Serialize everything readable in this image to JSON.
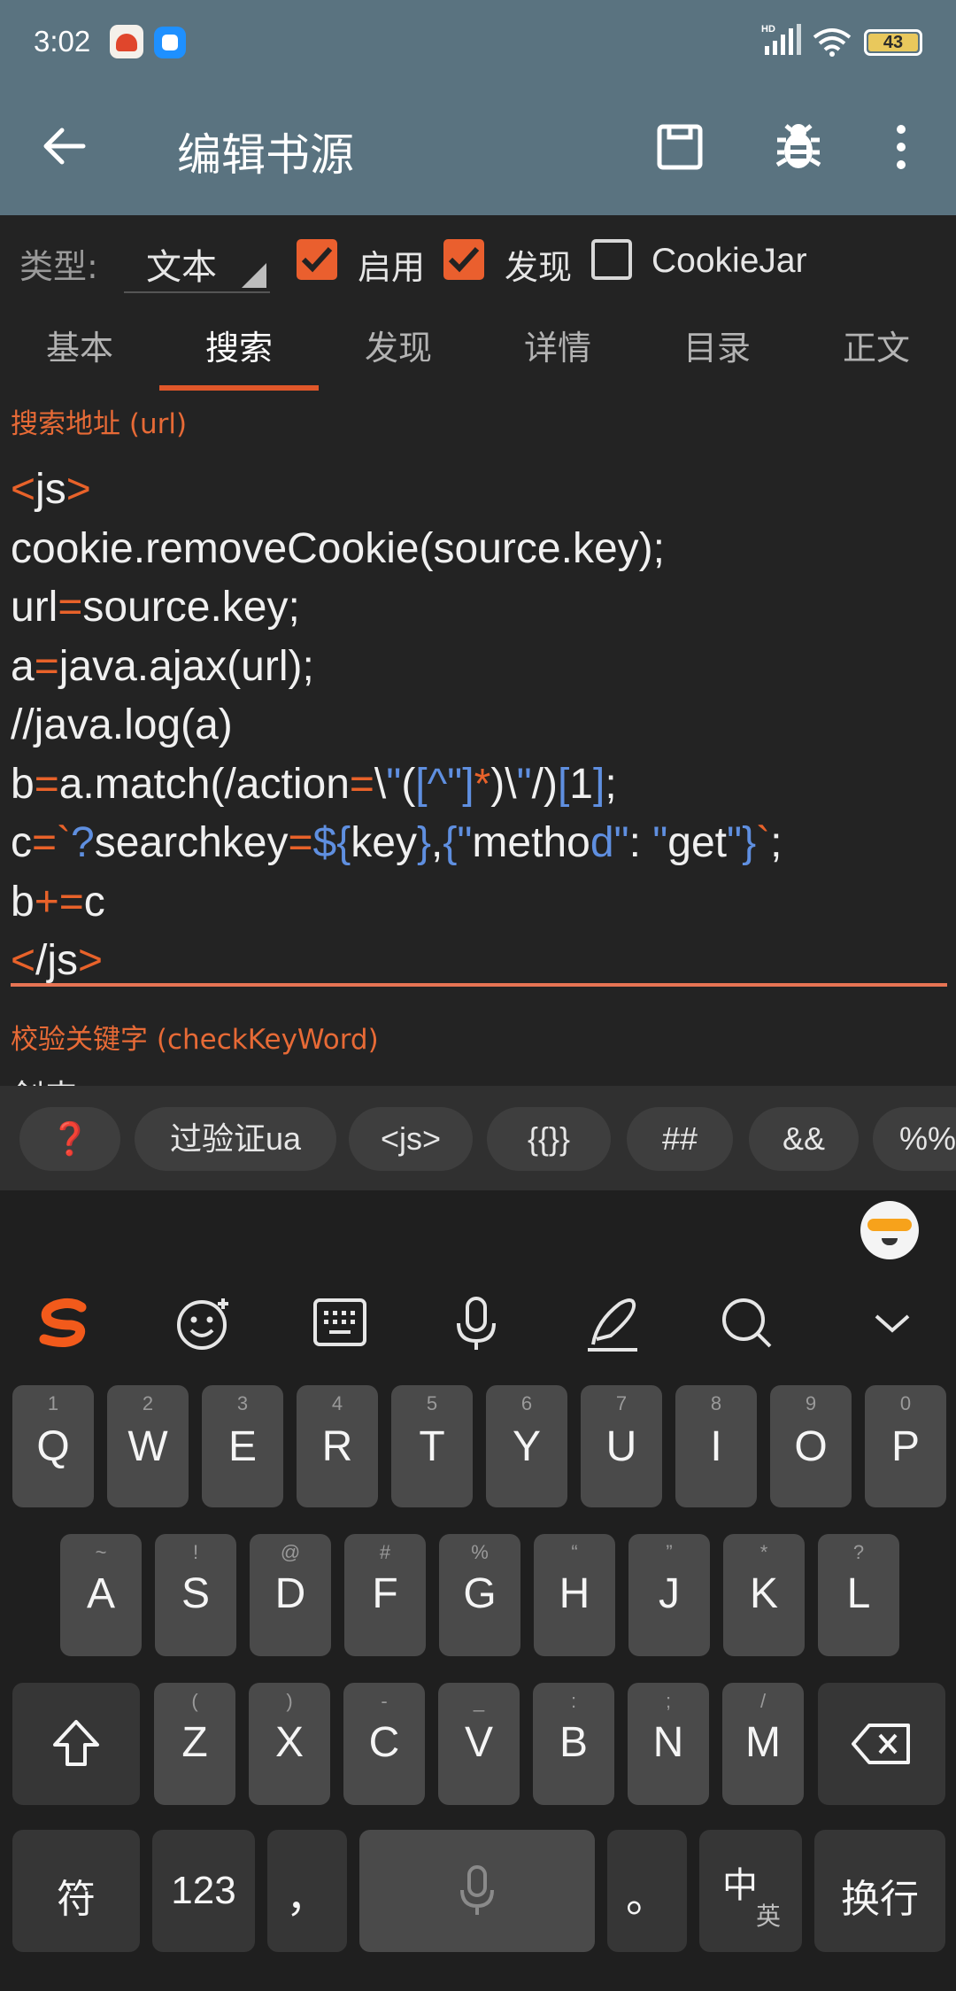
{
  "status": {
    "time": "3:02",
    "battery": "43",
    "battery_level": 0.43
  },
  "appbar": {
    "title": "编辑书源"
  },
  "options": {
    "type_label": "类型:",
    "type_value": "文本",
    "enable_label": "启用",
    "enable_checked": true,
    "discover_label": "发现",
    "discover_checked": true,
    "cookiejar_label": "CookieJar",
    "cookiejar_checked": false
  },
  "tabs": [
    {
      "label": "基本",
      "active": false
    },
    {
      "label": "搜索",
      "active": true
    },
    {
      "label": "发现",
      "active": false
    },
    {
      "label": "详情",
      "active": false
    },
    {
      "label": "目录",
      "active": false
    },
    {
      "label": "正文",
      "active": false
    }
  ],
  "editor": {
    "search_url_label": "搜索地址 (url)",
    "code_lines": [
      "<js>",
      "cookie.removeCookie(source.key);",
      "url=source.key;",
      "a=java.ajax(url);",
      "//java.log(a)",
      "b=a.match(/action=\\\"([^\"]*)\\\"/)[1];",
      "c=`?searchkey=${key},{\"method\": \"get\"}`;",
      "b+=c",
      "</js>"
    ],
    "check_keyword_label": "校验关键字 (checkKeyWord)",
    "check_keyword_value": "剑来"
  },
  "helper_chips": [
    "❓",
    "过验证ua",
    "<js>",
    "{{}}",
    "##",
    "&&",
    "%%"
  ],
  "keyboard": {
    "toolbar": [
      "sogou-logo-icon",
      "emoji-icon",
      "keyboard-icon",
      "microphone-icon",
      "handwriting-icon",
      "search-icon",
      "collapse-icon"
    ],
    "row1": [
      {
        "main": "Q",
        "sub": "1"
      },
      {
        "main": "W",
        "sub": "2"
      },
      {
        "main": "E",
        "sub": "3"
      },
      {
        "main": "R",
        "sub": "4"
      },
      {
        "main": "T",
        "sub": "5"
      },
      {
        "main": "Y",
        "sub": "6"
      },
      {
        "main": "U",
        "sub": "7"
      },
      {
        "main": "I",
        "sub": "8"
      },
      {
        "main": "O",
        "sub": "9"
      },
      {
        "main": "P",
        "sub": "0"
      }
    ],
    "row2": [
      {
        "main": "A",
        "sub": "~"
      },
      {
        "main": "S",
        "sub": "!"
      },
      {
        "main": "D",
        "sub": "@"
      },
      {
        "main": "F",
        "sub": "#"
      },
      {
        "main": "G",
        "sub": "%"
      },
      {
        "main": "H",
        "sub": "“"
      },
      {
        "main": "J",
        "sub": "”"
      },
      {
        "main": "K",
        "sub": "*"
      },
      {
        "main": "L",
        "sub": "?"
      }
    ],
    "row3": [
      {
        "main": "Z",
        "sub": "("
      },
      {
        "main": "X",
        "sub": ")"
      },
      {
        "main": "C",
        "sub": "-"
      },
      {
        "main": "V",
        "sub": "_"
      },
      {
        "main": "B",
        "sub": ":"
      },
      {
        "main": "N",
        "sub": ";"
      },
      {
        "main": "M",
        "sub": "/"
      }
    ],
    "symbol_key": "符",
    "numbers_key": "123",
    "comma_key": "，",
    "period_key": "。",
    "lang_key_primary": "中",
    "lang_key_secondary": "英",
    "enter_key": "换行"
  }
}
